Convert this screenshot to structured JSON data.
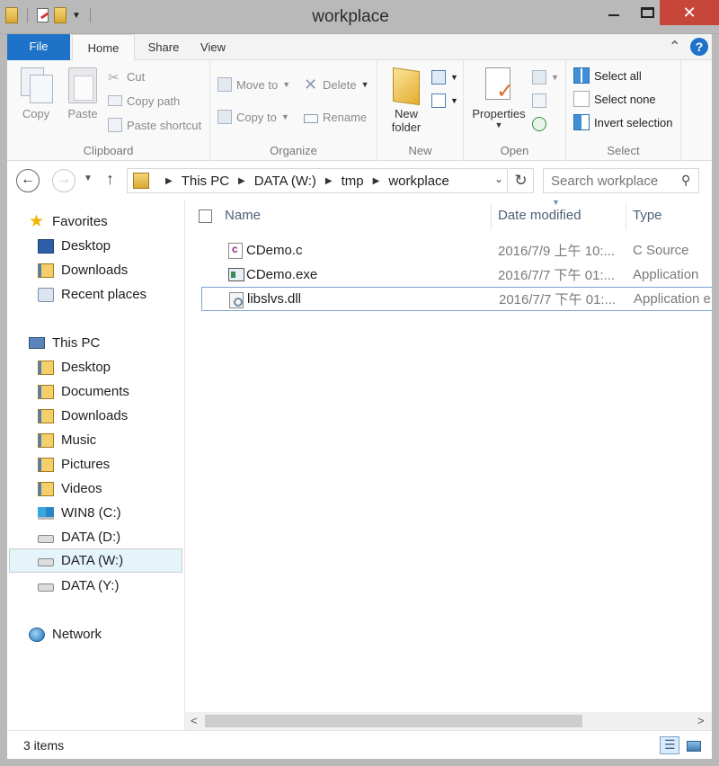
{
  "window": {
    "title": "workplace",
    "close_glyph": "✕"
  },
  "ribbon_tabs": {
    "file": "File",
    "home": "Home",
    "share": "Share",
    "view": "View"
  },
  "ribbon": {
    "clipboard": {
      "label": "Clipboard",
      "copy": "Copy",
      "paste": "Paste",
      "cut": "Cut",
      "copy_path": "Copy path",
      "paste_shortcut": "Paste shortcut"
    },
    "organize": {
      "label": "Organize",
      "move_to": "Move to",
      "copy_to": "Copy to",
      "delete": "Delete",
      "rename": "Rename"
    },
    "new": {
      "label": "New",
      "new_folder_line1": "New",
      "new_folder_line2": "folder"
    },
    "open": {
      "label": "Open",
      "properties": "Properties"
    },
    "select": {
      "label": "Select",
      "select_all": "Select all",
      "select_none": "Select none",
      "invert_selection": "Invert selection"
    }
  },
  "address": {
    "crumbs": [
      "This PC",
      "DATA (W:)",
      "tmp",
      "workplace"
    ],
    "search_placeholder": "Search workplace"
  },
  "nav_pane": {
    "favorites": "Favorites",
    "fav_items": [
      "Desktop",
      "Downloads",
      "Recent places"
    ],
    "this_pc": "This PC",
    "pc_items": [
      "Desktop",
      "Documents",
      "Downloads",
      "Music",
      "Pictures",
      "Videos",
      "WIN8 (C:)",
      "DATA (D:)",
      "DATA (W:)",
      "DATA (Y:)"
    ],
    "network": "Network"
  },
  "columns": {
    "name": "Name",
    "date_modified": "Date modified",
    "type": "Type"
  },
  "files": [
    {
      "name": "CDemo.c",
      "date": "2016/7/9 上午 10:...",
      "type": "C Source"
    },
    {
      "name": "CDemo.exe",
      "date": "2016/7/7 下午 01:...",
      "type": "Application"
    },
    {
      "name": "libslvs.dll",
      "date": "2016/7/7 下午 01:...",
      "type": "Application e"
    }
  ],
  "status": {
    "item_count": "3 items"
  }
}
